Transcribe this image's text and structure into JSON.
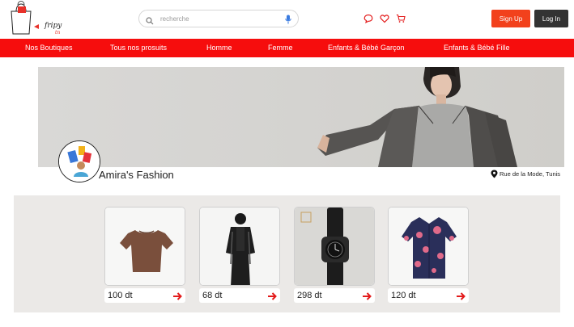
{
  "header": {
    "search_placeholder": "recherche",
    "signup_label": "Sign Up",
    "login_label": "Log In"
  },
  "nav": {
    "items": [
      {
        "label": "Nos Boutiques"
      },
      {
        "label": "Tous nos prosuits"
      },
      {
        "label": "Homme"
      },
      {
        "label": "Femme"
      },
      {
        "label": "Enfants & Bébé Garçon"
      },
      {
        "label": "Enfants & Bébé Fille"
      }
    ]
  },
  "shop": {
    "name": "Amira's Fashion",
    "location": "Rue de la Mode, Tunis"
  },
  "products": [
    {
      "price": "100 dt",
      "image": "brown-tshirt"
    },
    {
      "price": "68 dt",
      "image": "black-outfit"
    },
    {
      "price": "298 dt",
      "image": "wrist-watch"
    },
    {
      "price": "120 dt",
      "image": "floral-shirt"
    }
  ],
  "colors": {
    "brand_red": "#f60d0d",
    "signup": "#f2411c",
    "login": "#333333"
  }
}
